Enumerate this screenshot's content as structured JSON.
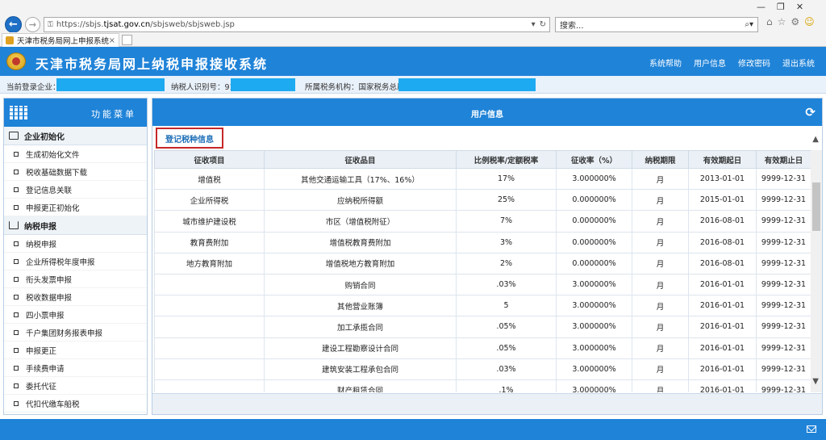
{
  "browser": {
    "url_prefix": "https://sbjs.",
    "url_domain": "tjsat.gov.cn",
    "url_path": "/sbjsweb/sbjsweb.jsp",
    "search_label": "搜索...",
    "tab_title": "天津市税务局网上申报系统...",
    "tab_close": "×"
  },
  "header": {
    "title": "天津市税务局网上纳税申报接收系统",
    "links": [
      "系统帮助",
      "用户信息",
      "修改密码",
      "退出系统"
    ]
  },
  "info": {
    "company_label": "当前登录企业：",
    "taxid_label": "纳税人识别号：91",
    "org_label": "所属税务机构：国家税务总局"
  },
  "sidebar": {
    "title": "功能菜单",
    "sections": [
      {
        "title": "企业初始化",
        "items": [
          "生成初始化文件",
          "税收基础数据下载",
          "登记信息关联",
          "申报更正初始化"
        ]
      },
      {
        "title": "纳税申报",
        "items": [
          "纳税申报",
          "企业所得税年度申报",
          "衔头发票申报",
          "税收数据申报",
          "四小票申报",
          "千户集团财务报表申报",
          "申报更正",
          "手续费申请",
          "委托代征",
          "代扣代缴车船税"
        ]
      }
    ]
  },
  "main": {
    "title": "用户信息",
    "subtab": "登记税种信息",
    "columns": [
      "征收项目",
      "征收品目",
      "比例税率/定额税率",
      "征收率（%）",
      "纳税期限",
      "有效期起日",
      "有效期止日"
    ],
    "rows": [
      [
        "增值税",
        "其他交通运输工具（17%、16%）",
        "17%",
        "3.000000%",
        "月",
        "2013-01-01",
        "9999-12-31"
      ],
      [
        "企业所得税",
        "应纳税所得额",
        "25%",
        "0.000000%",
        "月",
        "2015-01-01",
        "9999-12-31"
      ],
      [
        "城市维护建设税",
        "市区（增值税附征）",
        "7%",
        "0.000000%",
        "月",
        "2016-08-01",
        "9999-12-31"
      ],
      [
        "教育费附加",
        "增值税教育费附加",
        "3%",
        "0.000000%",
        "月",
        "2016-08-01",
        "9999-12-31"
      ],
      [
        "地方教育附加",
        "增值税地方教育附加",
        "2%",
        "0.000000%",
        "月",
        "2016-08-01",
        "9999-12-31"
      ],
      [
        "",
        "购销合同",
        ".03%",
        "3.000000%",
        "月",
        "2016-01-01",
        "9999-12-31"
      ],
      [
        "",
        "其他营业账簿",
        "5",
        "3.000000%",
        "月",
        "2016-01-01",
        "9999-12-31"
      ],
      [
        "",
        "加工承揽合同",
        ".05%",
        "3.000000%",
        "月",
        "2016-01-01",
        "9999-12-31"
      ],
      [
        "",
        "建设工程勘察设计合同",
        ".05%",
        "3.000000%",
        "月",
        "2016-01-01",
        "9999-12-31"
      ],
      [
        "",
        "建筑安装工程承包合同",
        ".03%",
        "3.000000%",
        "月",
        "2016-01-01",
        "9999-12-31"
      ],
      [
        "",
        "财产租赁合同",
        ".1%",
        "3.000000%",
        "月",
        "2016-01-01",
        "9999-12-31"
      ]
    ]
  }
}
